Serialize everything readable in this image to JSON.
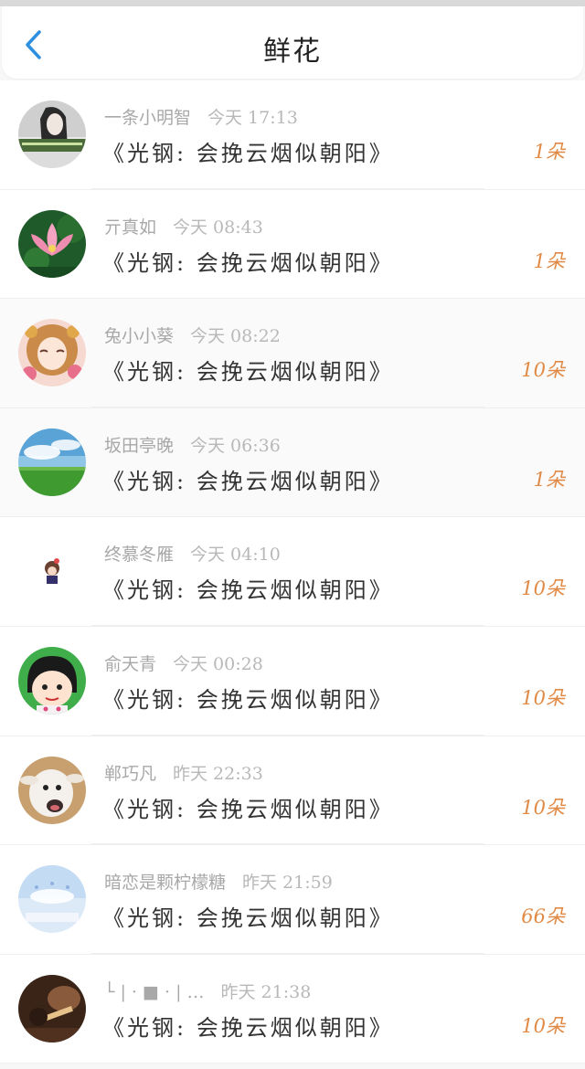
{
  "header": {
    "title": "鲜花",
    "back_icon": "chevron-left-icon",
    "accent_color": "#2d8fe0"
  },
  "colors": {
    "amount": "#e08a45",
    "meta": "#a8a8a8",
    "text": "#333333"
  },
  "rows": [
    {
      "username": "一条小明智",
      "time": "今天 17:13",
      "work": "《光钢: 会挽云烟似朝阳》",
      "amount": "1朵",
      "avatar": "avatar-photo-girl"
    },
    {
      "username": "亓真如",
      "time": "今天 08:43",
      "work": "《光钢: 会挽云烟似朝阳》",
      "amount": "1朵",
      "avatar": "avatar-lotus"
    },
    {
      "username": "兔小小葵",
      "time": "今天 08:22",
      "work": "《光钢: 会挽云烟似朝阳》",
      "amount": "10朵",
      "avatar": "avatar-anime-girl"
    },
    {
      "username": "坂田亭晚",
      "time": "今天 06:36",
      "work": "《光钢: 会挽云烟似朝阳》",
      "amount": "1朵",
      "avatar": "avatar-grassland"
    },
    {
      "username": "终慕冬雁",
      "time": "今天 04:10",
      "work": "《光钢: 会挽云烟似朝阳》",
      "amount": "10朵",
      "avatar": "avatar-chibi"
    },
    {
      "username": "俞天青",
      "time": "今天 00:28",
      "work": "《光钢: 会挽云烟似朝阳》",
      "amount": "10朵",
      "avatar": "avatar-cartoon"
    },
    {
      "username": "郸巧凡",
      "time": "昨天 22:33",
      "work": "《光钢: 会挽云烟似朝阳》",
      "amount": "10朵",
      "avatar": "avatar-goat"
    },
    {
      "username": "暗恋是颗柠檬糖",
      "time": "昨天 21:59",
      "work": "《光钢: 会挽云烟似朝阳》",
      "amount": "66朵",
      "avatar": "avatar-pastel"
    },
    {
      "username": "└ | · ■ · | …",
      "time": "昨天 21:38",
      "work": "《光钢: 会挽云烟似朝阳》",
      "amount": "10朵",
      "avatar": "avatar-dark-photo"
    }
  ]
}
